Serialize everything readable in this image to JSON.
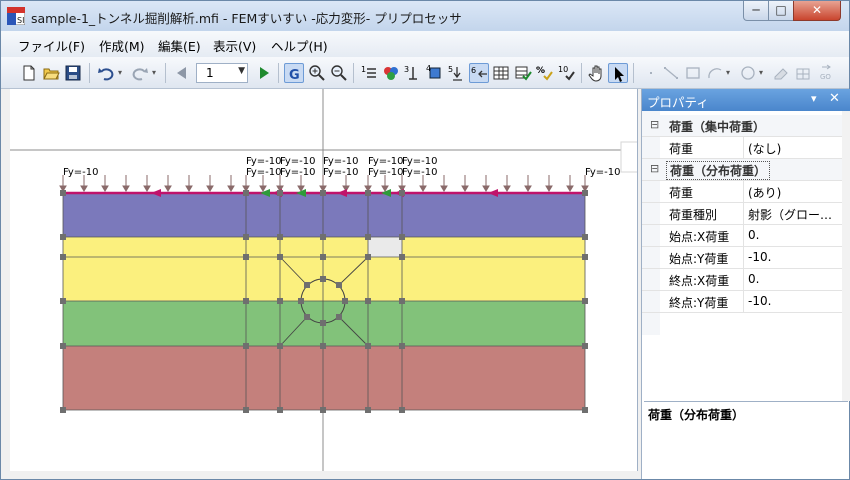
{
  "window": {
    "title": "sample-1_トンネル掘削解析.mfi - FEMすいすい -応力変形- プリプロセッサ",
    "app_icon_text": "SI",
    "controls": {
      "minimize": "─",
      "maximize": "□",
      "close": "✕"
    }
  },
  "menu": {
    "items": [
      {
        "label": "ファイル(F)"
      },
      {
        "label": "作成(M)"
      },
      {
        "label": "編集(E)"
      },
      {
        "label": "表示(V)"
      },
      {
        "label": "ヘルプ(H)"
      }
    ]
  },
  "toolbar": {
    "page_value": "1",
    "icons": [
      "new-file-icon",
      "open-folder-icon",
      "save-icon",
      "undo-icon",
      "redo-icon",
      "prev-icon",
      "play-icon",
      "grid-snap-icon",
      "zoom-in-icon",
      "zoom-out-icon",
      "hand-pan-icon",
      "pointer-icon"
    ]
  },
  "canvas": {
    "load_labels": [
      {
        "text": "Fy=-10"
      },
      {
        "text": "Fy=-10"
      },
      {
        "text": "Fy=-10"
      },
      {
        "text": "Fy=-10"
      },
      {
        "text": "Fy=-10"
      },
      {
        "text": "Fy=-10"
      },
      {
        "text": "Fy=-10"
      },
      {
        "text": "Fy=-10"
      },
      {
        "text": "Fy=-10"
      },
      {
        "text": "Fy=-10"
      },
      {
        "text": "Fy=-10"
      },
      {
        "text": "Fy=-10"
      },
      {
        "text": "Fy=-10"
      },
      {
        "text": "Fy=-10"
      }
    ],
    "colors": {
      "layer_1": "#7b79bb",
      "layer_2": "#fbf07e",
      "layer_3": "#82c27a",
      "layer_4": "#c4807c",
      "load_line": "#c0136b"
    }
  },
  "properties": {
    "header": "プロパティ",
    "pin": "▾",
    "close": "✕",
    "cat_point": "荷重（集中荷重）",
    "point_load_label": "荷重",
    "point_load_value": "(なし)",
    "cat_dist": "荷重（分布荷重）",
    "dist_load_label": "荷重",
    "dist_load_value": "(あり)",
    "type_label": "荷重種別",
    "type_value": "射影（グロー…",
    "start_x_label": "始点:X荷重",
    "start_x_value": "0.",
    "start_y_label": "始点:Y荷重",
    "start_y_value": "-10.",
    "end_x_label": "終点:X荷重",
    "end_x_value": "0.",
    "end_y_label": "終点:Y荷重",
    "end_y_value": "-10.",
    "toggle": "⊟",
    "description_title": "荷重（分布荷重）"
  }
}
